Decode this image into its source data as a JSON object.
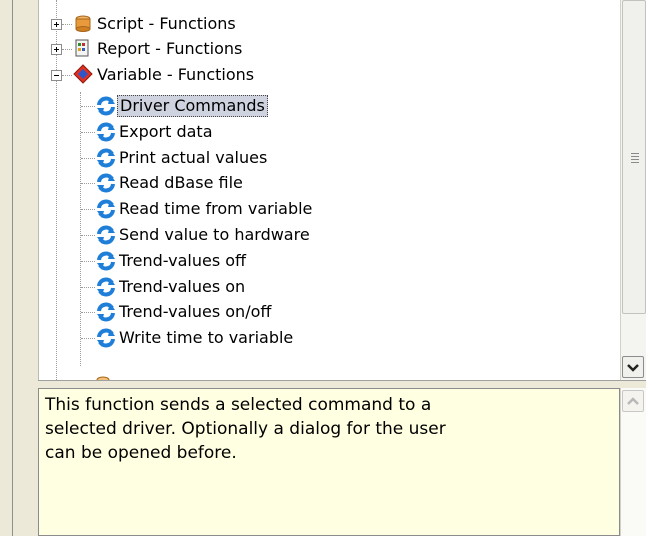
{
  "tree": {
    "categories": [
      {
        "label": "Script - Functions",
        "icon": "script-folder-icon",
        "state": "collapsed"
      },
      {
        "label": "Report - Functions",
        "icon": "report-icon",
        "state": "collapsed"
      },
      {
        "label": "Variable - Functions",
        "icon": "variable-diamond-icon",
        "state": "expanded"
      }
    ],
    "functions": [
      {
        "label": "Driver Commands",
        "selected": true
      },
      {
        "label": "Export data"
      },
      {
        "label": "Print actual values"
      },
      {
        "label": "Read dBase file"
      },
      {
        "label": "Read time from variable"
      },
      {
        "label": "Send value to hardware"
      },
      {
        "label": "Trend-values off"
      },
      {
        "label": "Trend-values on"
      },
      {
        "label": "Trend-values on/off"
      },
      {
        "label": "Write time to variable"
      }
    ],
    "function_icon": "blue-refresh-icon",
    "selection_color": "#cfd2df"
  },
  "description": {
    "lines": [
      "This function sends a selected command to a",
      "selected driver. Optionally a dialog for the user",
      "can be opened before."
    ],
    "background": "#ffffe1"
  }
}
